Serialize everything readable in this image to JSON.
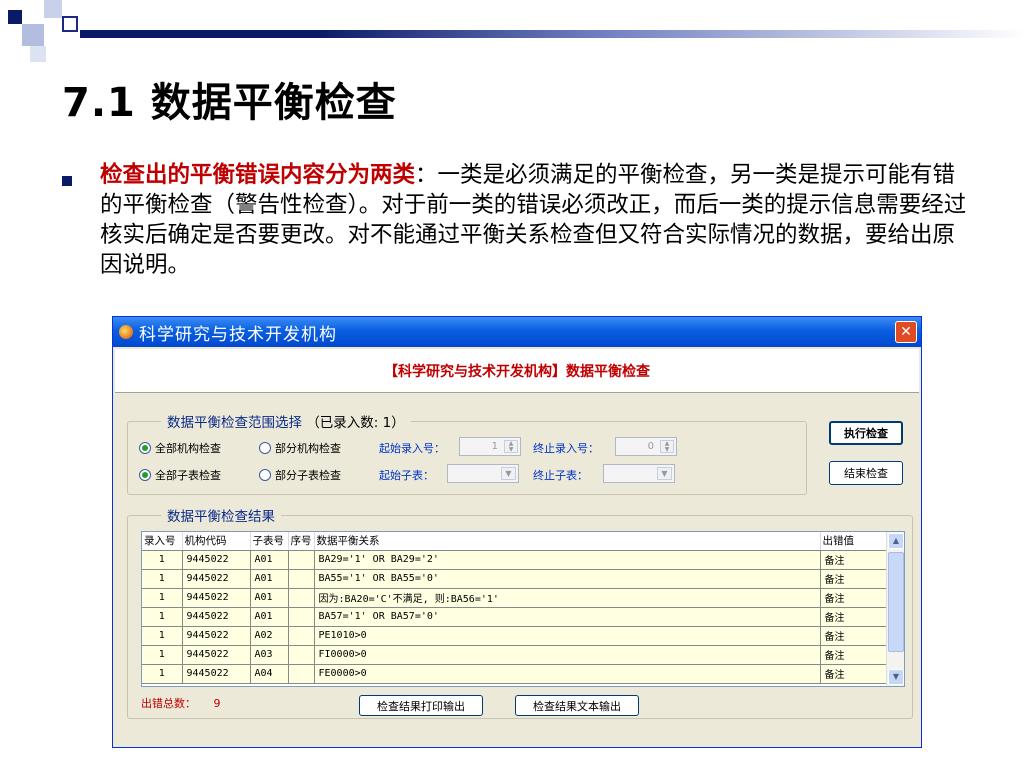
{
  "slide": {
    "title": "7.1 数据平衡检查",
    "highlight": "检查出的平衡错误内容分为两类",
    "colon": "：",
    "body": "一类是必须满足的平衡检查，另一类是提示可能有错的平衡检查（警告性检查）。对于前一类的错误必须改正，而后一类的提示信息需要经过核实后确定是否要更改。对不能通过平衡关系检查但又符合实际情况的数据，要给出原因说明。"
  },
  "window": {
    "title": "科学研究与技术开发机构",
    "close": "✕",
    "header": "【科学研究与技术开发机构】数据平衡检查"
  },
  "scope": {
    "legend": "数据平衡检查范围选择",
    "count_text": "（已录入数:      1）",
    "radio_all_org": "全部机构检查",
    "radio_part_org": "部分机构检查",
    "radio_all_sub": "全部子表检查",
    "radio_part_sub": "部分子表检查",
    "start_no_label": "起始录入号：",
    "start_no_value": "1",
    "end_no_label": "终止录入号：",
    "end_no_value": "0",
    "start_sub_label": "起始子表：",
    "end_sub_label": "终止子表："
  },
  "buttons": {
    "run": "执行检查",
    "end": "结束检查",
    "print": "检查结果打印输出",
    "text_out": "检查结果文本输出"
  },
  "results": {
    "legend": "数据平衡检查结果",
    "columns": [
      "录入号",
      "机构代码",
      "子表号",
      "序号",
      "数据平衡关系",
      "出错值"
    ],
    "rows": [
      [
        "1",
        "9445022",
        "A01",
        "",
        "BA29='1' OR BA29='2'",
        "备注"
      ],
      [
        "1",
        "9445022",
        "A01",
        "",
        "BA55='1' OR BA55='0'",
        "备注"
      ],
      [
        "1",
        "9445022",
        "A01",
        "",
        "因为:BA20='C'不满足, 则:BA56='1'",
        "备注"
      ],
      [
        "1",
        "9445022",
        "A01",
        "",
        "BA57='1' OR BA57='0'",
        "备注"
      ],
      [
        "1",
        "9445022",
        "A02",
        "",
        "PE1010>0",
        "备注"
      ],
      [
        "1",
        "9445022",
        "A03",
        "",
        "FI0000>0",
        "备注"
      ],
      [
        "1",
        "9445022",
        "A04",
        "",
        "FE0000>0",
        "备注"
      ]
    ],
    "error_label": "出错总数：",
    "error_count": "9"
  }
}
